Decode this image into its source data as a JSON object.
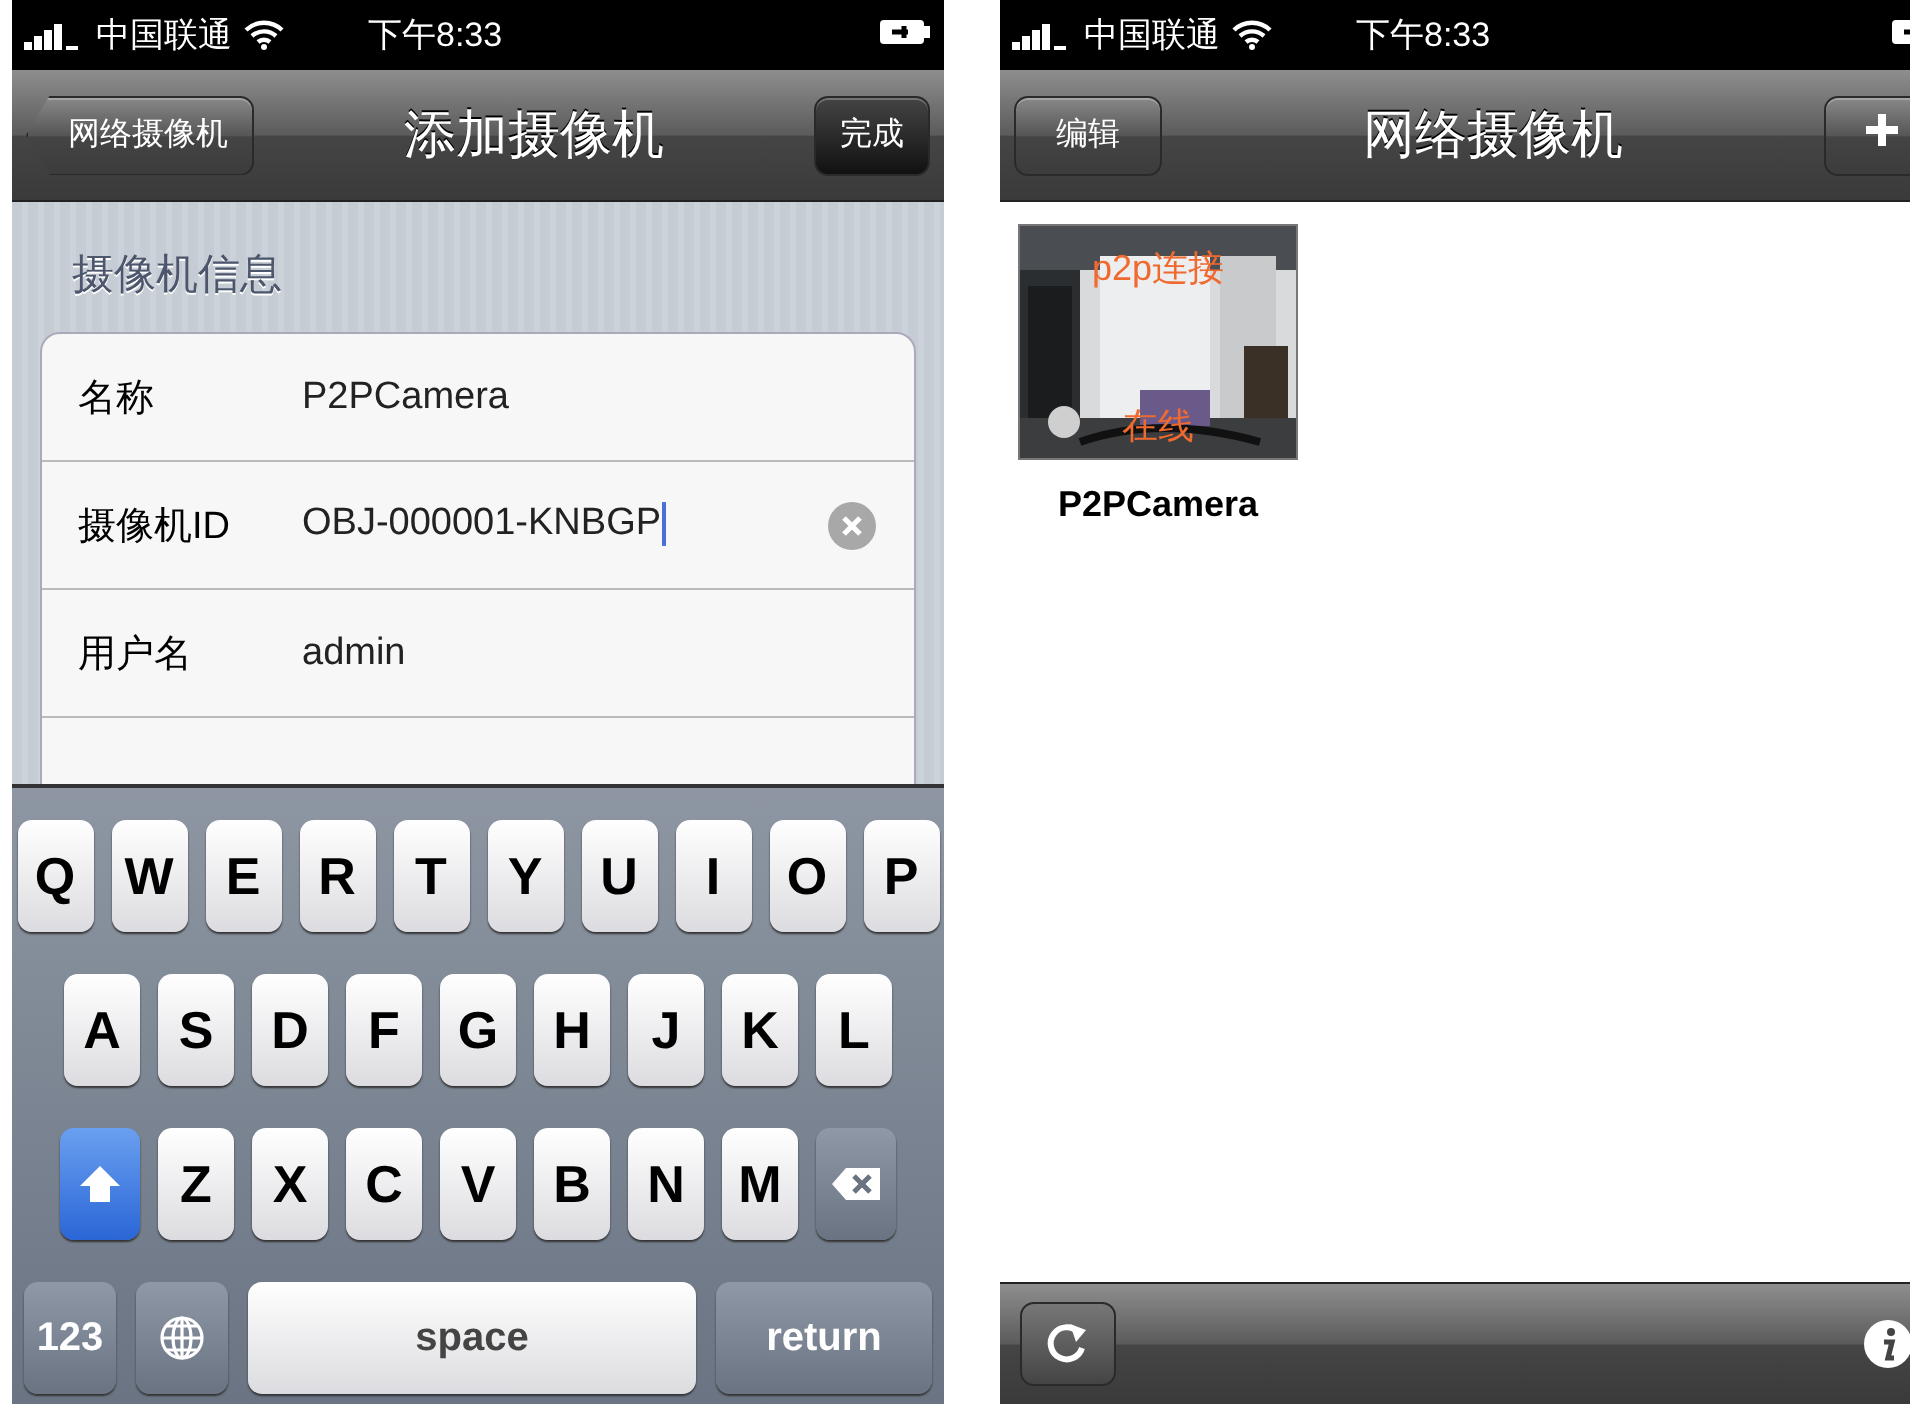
{
  "add_screen": {
    "status_bar": {
      "carrier": "中国联通",
      "time": "下午8:33"
    },
    "nav_bar": {
      "back_button": "网络摄像机",
      "title": "添加摄像机",
      "done_button": "完成"
    },
    "section_title": "摄像机信息",
    "fields": [
      {
        "label": "名称",
        "value": "P2PCamera",
        "focused": false
      },
      {
        "label": "摄像机ID",
        "value": "OBJ-000001-KNBGP",
        "focused": true
      },
      {
        "label": "用户名",
        "value": "admin",
        "focused": false
      }
    ],
    "keyboard": [
      [
        {
          "kind": "letter",
          "label": "Q"
        },
        {
          "kind": "letter",
          "label": "W"
        },
        {
          "kind": "letter",
          "label": "E"
        },
        {
          "kind": "letter",
          "label": "R"
        },
        {
          "kind": "letter",
          "label": "T"
        },
        {
          "kind": "letter",
          "label": "Y"
        },
        {
          "kind": "letter",
          "label": "U"
        },
        {
          "kind": "letter",
          "label": "I"
        },
        {
          "kind": "letter",
          "label": "O"
        },
        {
          "kind": "letter",
          "label": "P"
        }
      ],
      [
        {
          "kind": "letter",
          "label": "A"
        },
        {
          "kind": "letter",
          "label": "S"
        },
        {
          "kind": "letter",
          "label": "D"
        },
        {
          "kind": "letter",
          "label": "F"
        },
        {
          "kind": "letter",
          "label": "G"
        },
        {
          "kind": "letter",
          "label": "H"
        },
        {
          "kind": "letter",
          "label": "J"
        },
        {
          "kind": "letter",
          "label": "K"
        },
        {
          "kind": "letter",
          "label": "L"
        }
      ],
      [
        {
          "kind": "shift",
          "on": true
        },
        {
          "kind": "letter",
          "label": "Z"
        },
        {
          "kind": "letter",
          "label": "X"
        },
        {
          "kind": "letter",
          "label": "C"
        },
        {
          "kind": "letter",
          "label": "V"
        },
        {
          "kind": "letter",
          "label": "B"
        },
        {
          "kind": "letter",
          "label": "N"
        },
        {
          "kind": "letter",
          "label": "M"
        },
        {
          "kind": "delete"
        }
      ],
      [
        {
          "kind": "mode",
          "label": "123"
        },
        {
          "kind": "globe"
        },
        {
          "kind": "space",
          "label": "space"
        },
        {
          "kind": "return",
          "label": "return"
        }
      ]
    ]
  },
  "list_screen": {
    "status_bar": {
      "carrier": "中国联通",
      "time": "下午8:33"
    },
    "nav_bar": {
      "edit_button": "编辑",
      "title": "网络摄像机"
    },
    "cameras": [
      {
        "name": "P2PCamera",
        "connection": "p2p连接",
        "status": "在线"
      }
    ]
  }
}
